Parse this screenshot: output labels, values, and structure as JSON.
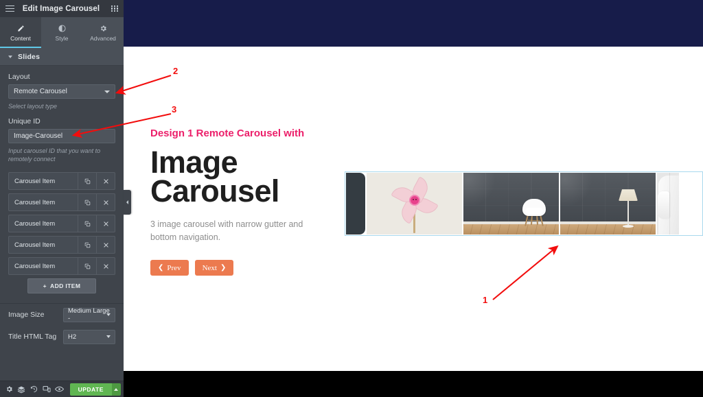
{
  "panel": {
    "header": {
      "title": "Edit Image Carousel",
      "burger_icon": "hamburger-menu-icon",
      "grid_icon": "app-grid-icon"
    },
    "tabs": [
      {
        "label": "Content",
        "icon": "pencil-icon",
        "active": true
      },
      {
        "label": "Style",
        "icon": "contrast-icon",
        "active": false
      },
      {
        "label": "Advanced",
        "icon": "gear-icon",
        "active": false
      }
    ],
    "section": {
      "title": "Slides"
    },
    "controls": {
      "layout_label": "Layout",
      "layout_value": "Remote Carousel",
      "layout_hint": "Select layout type",
      "unique_id_label": "Unique ID",
      "unique_id_value": "Image-Carousel",
      "unique_id_hint": "Input carousel ID that you want to remotely connect",
      "image_size_label": "Image Size",
      "image_size_value": "Medium Large -",
      "title_tag_label": "Title HTML Tag",
      "title_tag_value": "H2"
    },
    "repeater": {
      "items": [
        {
          "title": "Carousel Item"
        },
        {
          "title": "Carousel Item"
        },
        {
          "title": "Carousel Item"
        },
        {
          "title": "Carousel Item"
        },
        {
          "title": "Carousel Item"
        }
      ],
      "duplicate_icon": "copy-icon",
      "remove_icon": "close-x-icon",
      "add_label": "ADD ITEM",
      "add_plus": "+"
    },
    "footer": {
      "icons": [
        "settings-gear-icon",
        "layers-icon",
        "history-revisions-icon",
        "responsive-mode-icon",
        "preview-eye-icon"
      ],
      "update_label": "UPDATE",
      "update_caret_icon": "chevron-up-icon"
    },
    "collapse_handle_icon": "chevron-right-icon"
  },
  "canvas": {
    "eyebrow": "Design 1 Remote Carousel with",
    "title_line1": "Image",
    "title_line2": "Carousel",
    "subtitle": "3 image carousel with narrow gutter and bottom navigation.",
    "nav": {
      "prev_label": "Prev",
      "prev_icon": "chevron-left-icon",
      "next_label": "Next",
      "next_icon": "chevron-right-icon"
    },
    "carousel": {
      "slides": [
        {
          "kind": "partial-left",
          "art": "dark-wall-sliver"
        },
        {
          "kind": "full",
          "art": "pink-pinwheel-on-cream"
        },
        {
          "kind": "full",
          "art": "white-chair-dark-wall-wood-floor"
        },
        {
          "kind": "full",
          "art": "floor-lamp-dark-wall-wood-floor"
        },
        {
          "kind": "partial-right",
          "art": "white-robe"
        }
      ]
    }
  },
  "annotations": [
    {
      "label": "1"
    },
    {
      "label": "2"
    },
    {
      "label": "3"
    }
  ],
  "colors": {
    "panel_bg": "#3f444b",
    "panel_dark": "#34383f",
    "tab_active_underline": "#5fc8e8",
    "topbar_navy": "#171c4a",
    "accent_pink": "#ec1f6a",
    "button_orange": "#ec7a4f",
    "update_green": "#60b652",
    "annotation_red": "#f20d0d",
    "selection_blue": "#a8d8ee"
  }
}
